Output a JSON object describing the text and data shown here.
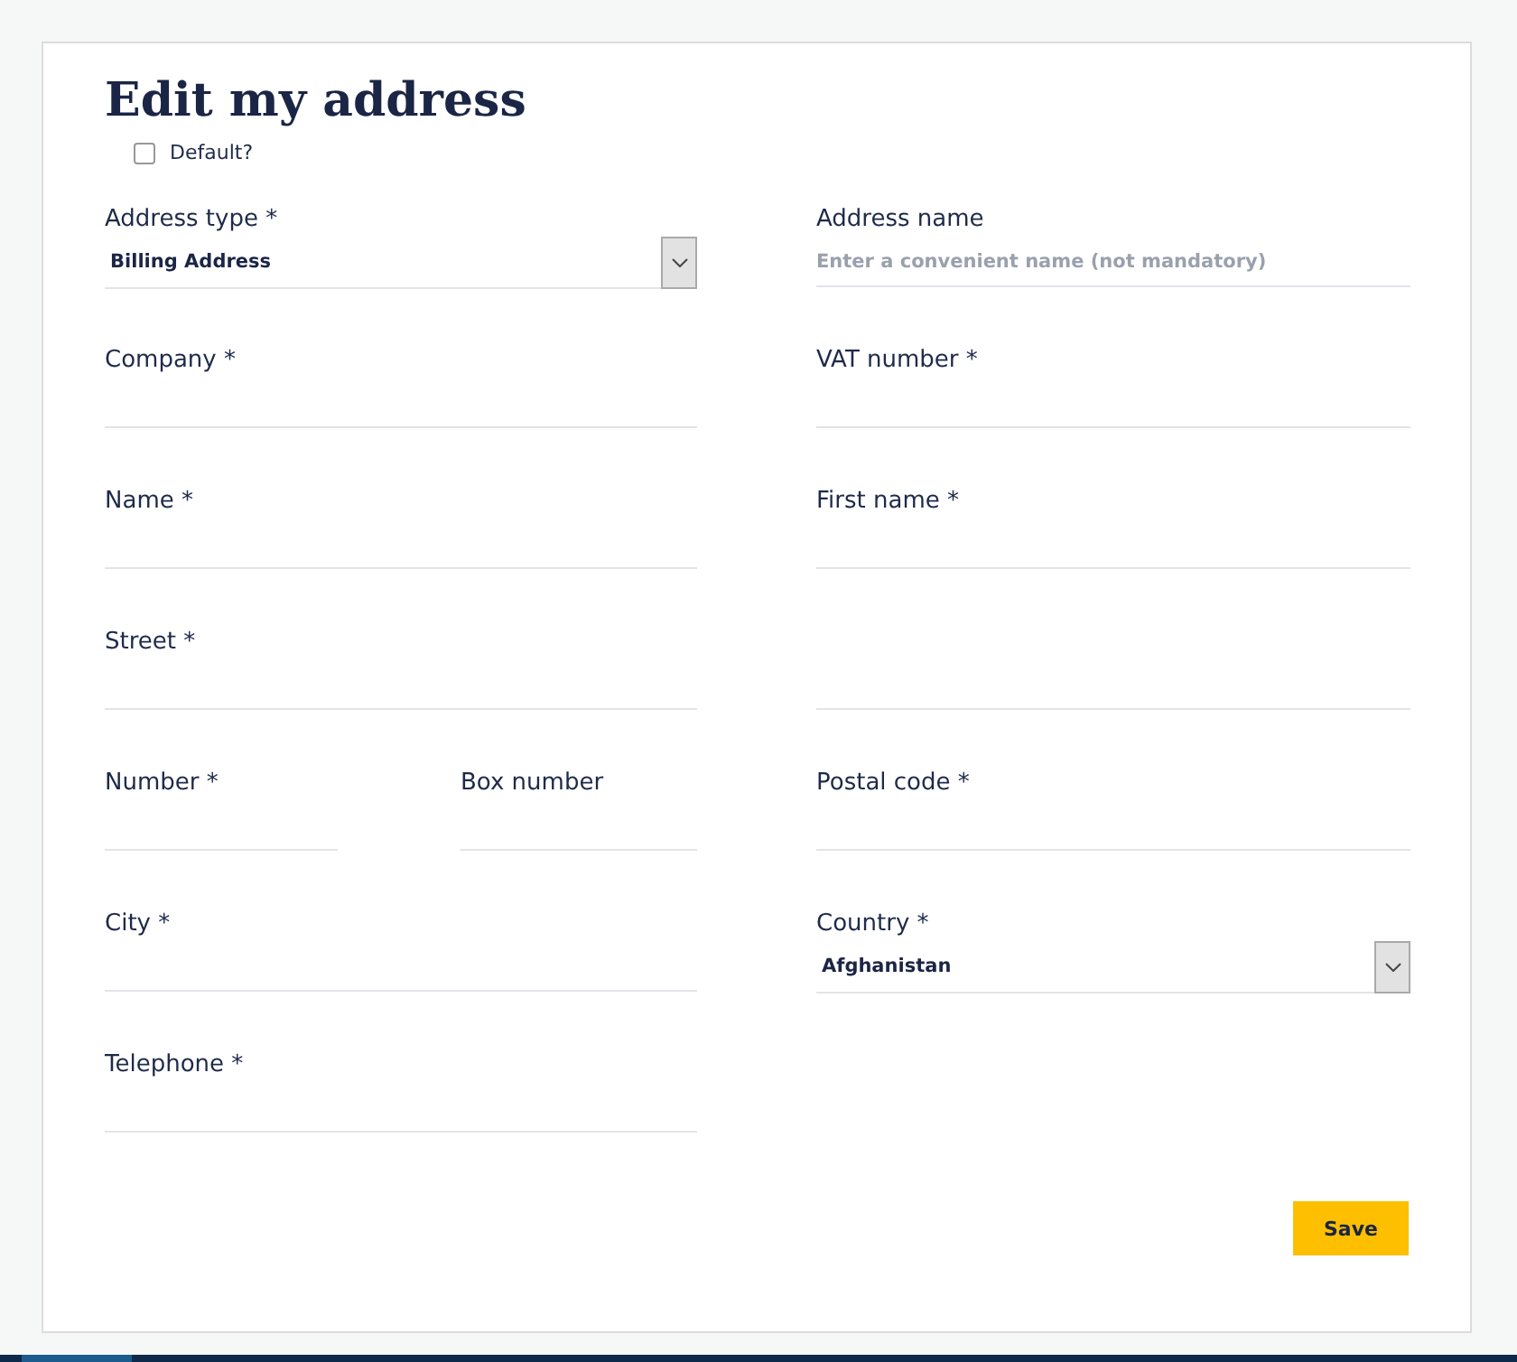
{
  "title": "Edit my address",
  "default_checkbox": {
    "label": "Default?",
    "checked": false
  },
  "rows": [
    [
      {
        "kind": "select",
        "label": "Address type *",
        "value": "Billing Address"
      },
      {
        "kind": "text",
        "label": "Address name",
        "placeholder": "Enter a convenient name (not mandatory)"
      }
    ],
    [
      {
        "kind": "text",
        "label": "Company *"
      },
      {
        "kind": "text",
        "label": "VAT number *"
      }
    ],
    [
      {
        "kind": "text",
        "label": "Name *"
      },
      {
        "kind": "text",
        "label": "First name *"
      }
    ],
    [
      {
        "kind": "text",
        "label": "Street *"
      },
      {
        "kind": "text"
      }
    ],
    [
      {
        "kind": "pair",
        "items": [
          {
            "kind": "text",
            "label": "Number *"
          },
          {
            "kind": "text",
            "label": "Box number"
          }
        ]
      },
      {
        "kind": "text",
        "label": "Postal code *"
      }
    ],
    [
      {
        "kind": "text",
        "label": "City *"
      },
      {
        "kind": "select",
        "label": "Country *",
        "value": "Afghanistan"
      }
    ],
    [
      {
        "kind": "text",
        "label": "Telephone *"
      }
    ]
  ],
  "save_button": "Save"
}
